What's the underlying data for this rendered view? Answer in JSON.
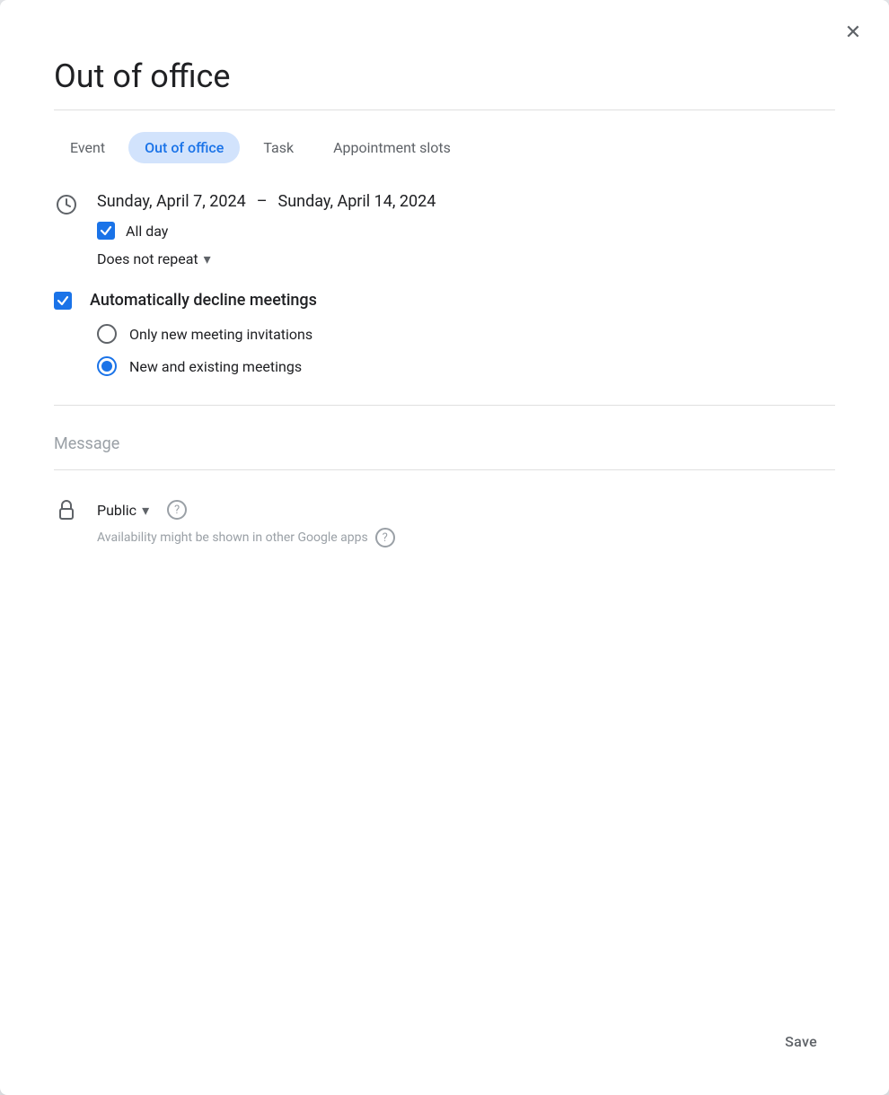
{
  "dialog": {
    "title": "Out of office",
    "close_label": "×"
  },
  "tabs": [
    {
      "id": "event",
      "label": "Event",
      "active": false
    },
    {
      "id": "out-of-office",
      "label": "Out of office",
      "active": true
    },
    {
      "id": "task",
      "label": "Task",
      "active": false
    },
    {
      "id": "appointment-slots",
      "label": "Appointment slots",
      "active": false
    }
  ],
  "date_range": {
    "start": "Sunday, April 7, 2024",
    "separator": "–",
    "end": "Sunday, April 14, 2024"
  },
  "all_day": {
    "checked": true,
    "label": "All day"
  },
  "repeat": {
    "label": "Does not repeat"
  },
  "auto_decline": {
    "checked": true,
    "label": "Automatically decline meetings"
  },
  "radio_options": [
    {
      "id": "new-only",
      "label": "Only new meeting invitations",
      "selected": false
    },
    {
      "id": "new-existing",
      "label": "New and existing meetings",
      "selected": true
    }
  ],
  "message": {
    "placeholder": "Message"
  },
  "visibility": {
    "icon_label": "lock-icon",
    "label": "Public",
    "help_text": "?"
  },
  "availability_note": {
    "text": "Availability might be shown in other Google apps",
    "help_text": "?"
  },
  "footer": {
    "save_label": "Save"
  }
}
